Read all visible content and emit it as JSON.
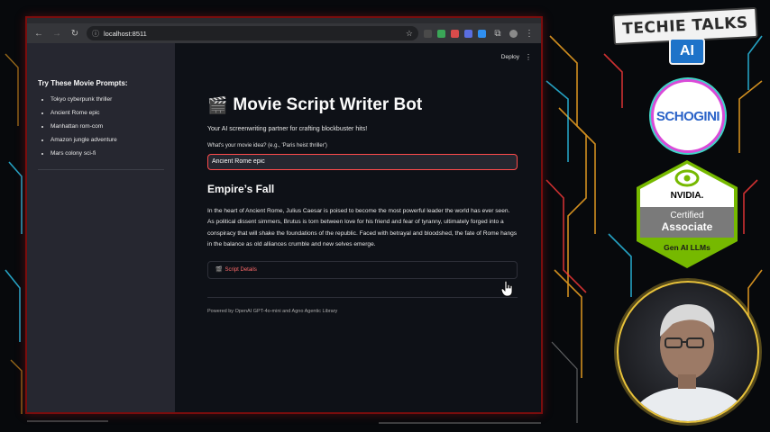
{
  "browser": {
    "url": "localhost:8511"
  },
  "app": {
    "deploy_label": "Deploy",
    "sidebar": {
      "heading": "Try These Movie Prompts:",
      "items": [
        "Tokyo cyberpunk thriller",
        "Ancient Rome epic",
        "Manhattan rom-com",
        "Amazon jungle adventure",
        "Mars colony sci-fi"
      ]
    },
    "title": "Movie Script Writer Bot",
    "title_icon": "clapperboard-icon",
    "subtitle": "Your AI screenwriting partner for crafting blockbuster hits!",
    "input": {
      "label": "What's your movie idea? (e.g., 'Paris heist thriller')",
      "value": "Ancient Rome epic"
    },
    "story": {
      "title": "Empire’s Fall",
      "body": "In the heart of Ancient Rome, Julius Caesar is poised to become the most powerful leader the world has ever seen. As political dissent simmers, Brutus is torn between love for his friend and fear of tyranny, ultimately forged into a conspiracy that will shake the foundations of the republic. Faced with betrayal and bloodshed, the fate of Rome hangs in the balance as old alliances crumble and new selves emerge."
    },
    "expander_label": "Script Details",
    "footer": "Powered by OpenAI GPT-4o-mini and Agno Agentic Library"
  },
  "branding": {
    "channel_name": "TECHIE TALKS",
    "channel_tag": "AI",
    "logo_text": "SCHOGINI",
    "badge": {
      "vendor": "NVIDIA.",
      "certified": "Certified",
      "level": "Associate",
      "track": "Gen AI LLMs"
    }
  },
  "colors": {
    "accent": "#ff4b4b",
    "sidebar_bg": "#262730",
    "main_bg": "#0e1117",
    "nvidia_green": "#76b900",
    "frame_red": "#7a0d0d"
  }
}
